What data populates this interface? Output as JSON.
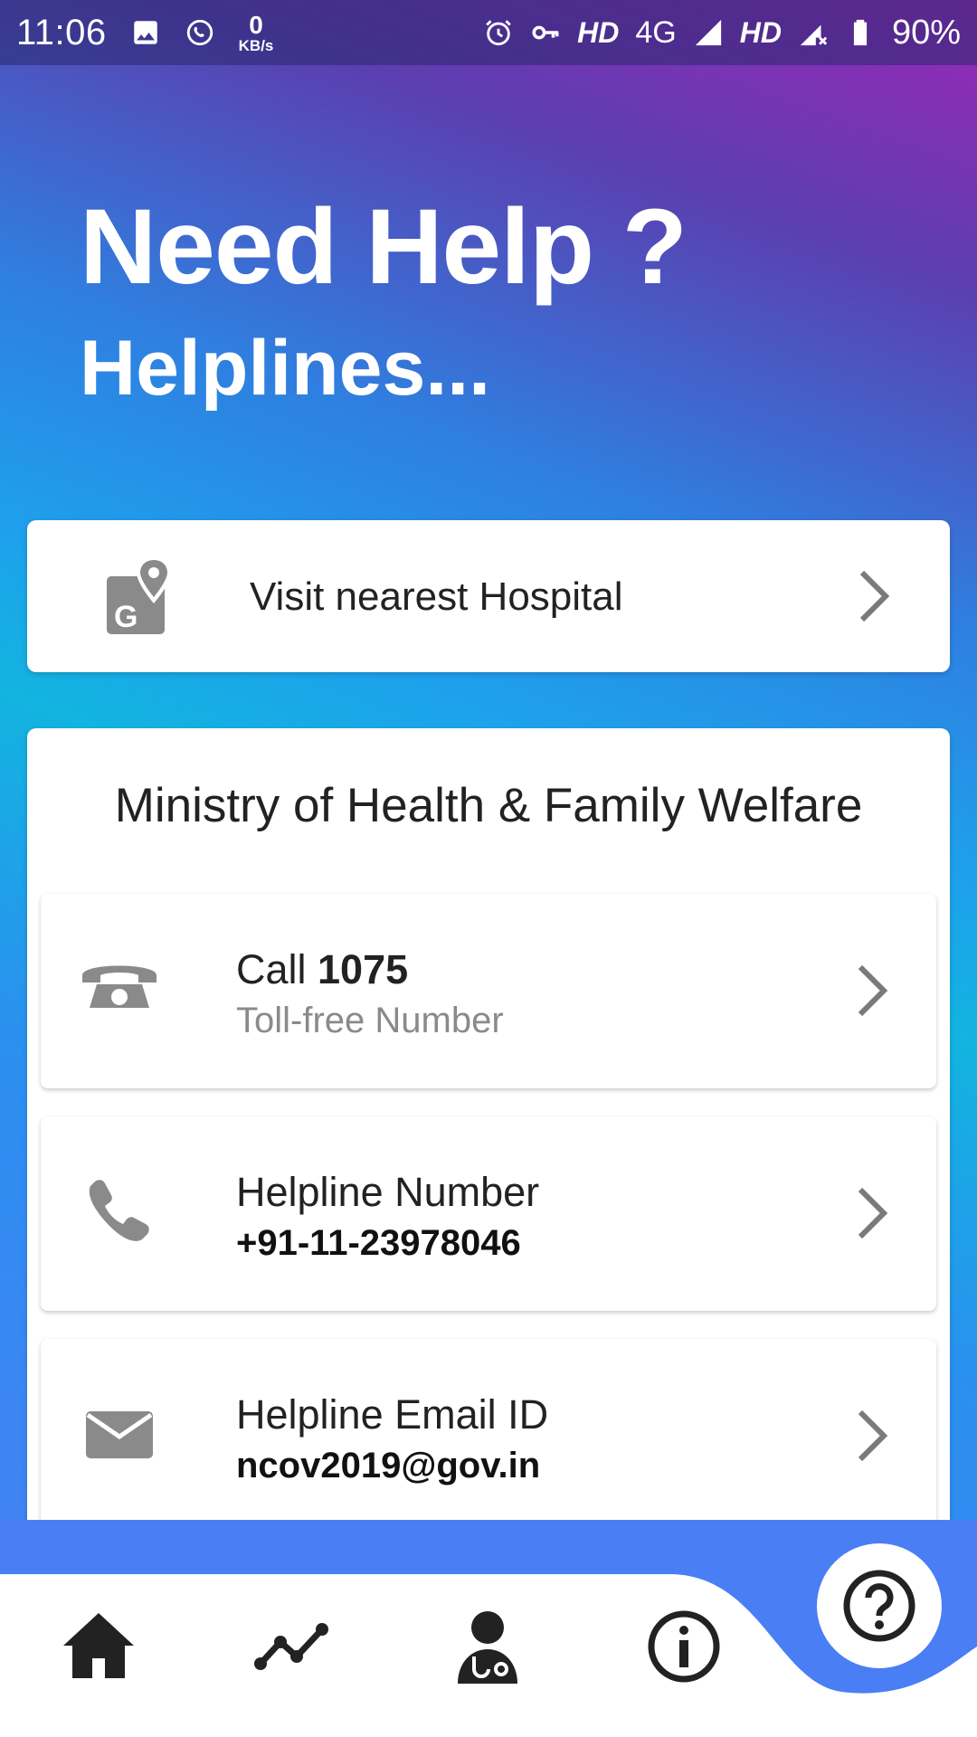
{
  "status_bar": {
    "time": "11:06",
    "net_speed_value": "0",
    "net_speed_unit": "KB/s",
    "hd1": "HD",
    "network": "4G",
    "hd2": "HD",
    "battery": "90%",
    "icons": [
      "image-icon",
      "whatsapp-icon",
      "alarm-icon",
      "vpn-key-icon",
      "signal-icon",
      "signal-x-icon",
      "battery-icon"
    ]
  },
  "header": {
    "title": "Need Help ?",
    "subtitle": "Helplines..."
  },
  "hospital_card": {
    "label": "Visit nearest Hospital",
    "icon": "map-pin-icon"
  },
  "ministry": {
    "title": "Ministry of Health & Family Welfare",
    "items": [
      {
        "title_prefix": "Call ",
        "title_bold": "1075",
        "subtitle": "Toll-free Number",
        "icon": "telephone-icon"
      },
      {
        "title_prefix": "Helpline Number",
        "title_bold": "",
        "subtitle": "+91-11-23978046",
        "icon": "phone-handset-icon"
      },
      {
        "title_prefix": "Helpline Email ID",
        "title_bold": "",
        "subtitle": "ncov2019@gov.in",
        "icon": "mail-icon"
      }
    ]
  },
  "bottom_nav": {
    "items": [
      "home-icon",
      "stats-icon",
      "doctor-icon",
      "info-icon"
    ],
    "active": "help-icon"
  },
  "colors": {
    "accent": "#4a7ef5",
    "icon_grey": "#8a8a8a",
    "text_dark": "#222222"
  }
}
